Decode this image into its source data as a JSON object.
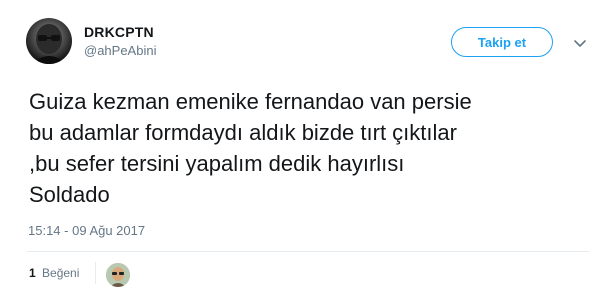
{
  "user": {
    "display_name": "DRKCPTN",
    "handle": "@ahPeAbini",
    "avatar_icon": "profile-avatar-icon"
  },
  "follow_button": {
    "label": "Takip et",
    "color": "#1da1f2"
  },
  "menu": {
    "icon": "chevron-down-icon"
  },
  "tweet": {
    "text": "Guiza kezman emenike fernandao van persie\nbu adamlar formdaydı aldık bizde tırt çıktılar\n,bu sefer tersini yapalım dedik hayırlısı\nSoldado",
    "timestamp": "15:14 - 09 Ağu 2017"
  },
  "stats": {
    "like_count": "1",
    "like_label": "Beğeni",
    "liker_avatar_icon": "liker-avatar-icon"
  },
  "colors": {
    "text_primary": "#14171a",
    "text_secondary": "#657786",
    "accent": "#1da1f2",
    "divider": "#e6ecf0"
  }
}
